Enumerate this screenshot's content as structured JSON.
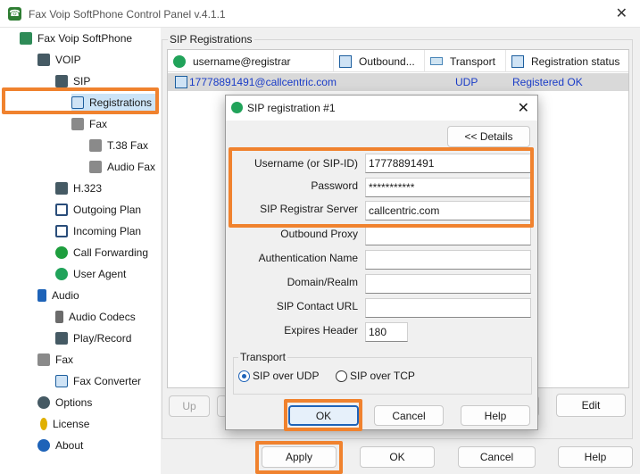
{
  "window": {
    "title": "Fax Voip SoftPhone Control Panel v.4.1.1",
    "close": "✕"
  },
  "tree": {
    "items": [
      {
        "label": "Fax Voip SoftPhone",
        "icon": "phone-icon"
      },
      {
        "label": "VOIP",
        "icon": "voip-icon"
      },
      {
        "label": "SIP",
        "icon": "sip-icon"
      },
      {
        "label": "Registrations",
        "icon": "monitor-icon"
      },
      {
        "label": "Fax",
        "icon": "fax-icon"
      },
      {
        "label": "T.38 Fax",
        "icon": "fax-icon"
      },
      {
        "label": "Audio Fax",
        "icon": "fax-icon"
      },
      {
        "label": "H.323",
        "icon": "h323-icon"
      },
      {
        "label": "Outgoing Plan",
        "icon": "network-icon"
      },
      {
        "label": "Incoming Plan",
        "icon": "network-icon"
      },
      {
        "label": "Call Forwarding",
        "icon": "call-forwarding-icon"
      },
      {
        "label": "User Agent",
        "icon": "user-icon"
      },
      {
        "label": "Audio",
        "icon": "music-note-icon"
      },
      {
        "label": "Audio Codecs",
        "icon": "speaker-icon"
      },
      {
        "label": "Play/Record",
        "icon": "recorder-icon"
      },
      {
        "label": "Fax",
        "icon": "fax-icon"
      },
      {
        "label": "Fax Converter",
        "icon": "picture-icon"
      },
      {
        "label": "Options",
        "icon": "gear-icon"
      },
      {
        "label": "License",
        "icon": "key-icon"
      },
      {
        "label": "About",
        "icon": "help-icon"
      }
    ]
  },
  "registrations": {
    "group_label": "SIP Registrations",
    "columns": [
      {
        "label": "username@registrar",
        "icon": "user-icon"
      },
      {
        "label": "Outbound...",
        "icon": "monitor-icon"
      },
      {
        "label": "Transport",
        "icon": "transport-icon"
      },
      {
        "label": "Registration status",
        "icon": "monitor-icon"
      }
    ],
    "rows": [
      {
        "username": "17778891491@callcentric.com",
        "outbound": "",
        "transport": "UDP",
        "status": "Registered OK"
      }
    ],
    "buttons": {
      "up": "Up",
      "edit": "Edit"
    }
  },
  "dialog": {
    "title": "SIP registration #1",
    "close": "✕",
    "details_button": "<< Details",
    "fields": {
      "username": {
        "label": "Username (or SIP-ID)",
        "value": "17778891491"
      },
      "password": {
        "label": "Password",
        "value": "***********"
      },
      "registrar": {
        "label": "SIP Registrar Server",
        "value": "callcentric.com"
      },
      "outbound_proxy": {
        "label": "Outbound Proxy",
        "value": ""
      },
      "auth_name": {
        "label": "Authentication Name",
        "value": ""
      },
      "domain": {
        "label": "Domain/Realm",
        "value": ""
      },
      "contact_url": {
        "label": "SIP Contact URL",
        "value": ""
      },
      "expires": {
        "label": "Expires Header",
        "value": "180"
      }
    },
    "transport": {
      "label": "Transport",
      "udp": "SIP over UDP",
      "tcp": "SIP over TCP",
      "selected": "udp"
    },
    "buttons": {
      "ok": "OK",
      "cancel": "Cancel",
      "help": "Help"
    }
  },
  "footer": {
    "apply": "Apply",
    "ok": "OK",
    "cancel": "Cancel",
    "help": "Help"
  },
  "colors": {
    "highlight": "#f0822e",
    "link": "#1a3cc7",
    "selection": "#cce4f7"
  }
}
